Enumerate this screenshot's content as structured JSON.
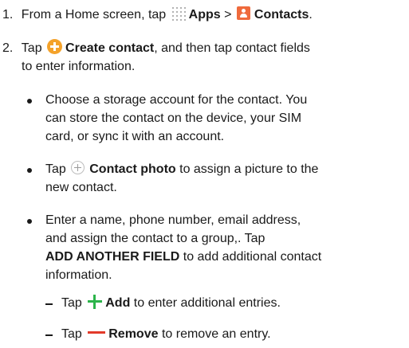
{
  "step1": {
    "number": "1.",
    "text_a": "From a Home screen, tap",
    "apps_label": "Apps",
    "separator": ">",
    "contacts_label": "Contacts",
    "end": "."
  },
  "step2": {
    "number": "2.",
    "text_a": "Tap",
    "create_label": "Create contact",
    "line1_rest": ", and then tap contact fields",
    "line2": "to enter information."
  },
  "bullet1": {
    "line1": "Choose a storage account for the contact. You",
    "line2": "can store the contact on the device, your SIM",
    "line3": "card, or sync it with an account."
  },
  "bullet2": {
    "text_a": "Tap",
    "photo_label": "Contact photo",
    "line1_rest": " to assign a picture to the",
    "line2": "new contact."
  },
  "bullet3": {
    "line1": "Enter a name, phone number, email address,",
    "line2": "and assign the contact to a group,. Tap",
    "field_label": "ADD ANOTHER FIELD",
    "line3_rest": " to add additional contact",
    "line4": "information."
  },
  "sub1": {
    "text_a": "Tap",
    "add_label": "Add",
    "rest": " to enter additional entries."
  },
  "sub2": {
    "text_a": "Tap",
    "remove_label": "Remove",
    "rest": " to remove an entry."
  },
  "colors": {
    "apps_icon": "#9a9a9a",
    "contacts_icon": "#ef6a3c",
    "create_icon": "#f4a22a",
    "add_icon": "#2bb44a",
    "remove_icon": "#e23a2a"
  }
}
